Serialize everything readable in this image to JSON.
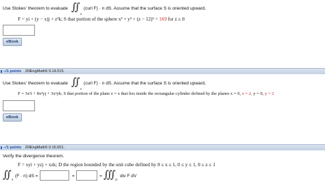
{
  "q1": {
    "intro": "Use Stokes' theorem to evaluate",
    "integrand": "(curl F) · n dS.  Assume that the surface S is oriented upward.",
    "integral_sub": "S",
    "field_line": "F = yi + (y − x)j + z²k;  S that portion of the sphere  x² + y² + (z − 12)² =",
    "field_value_red": "169",
    "field_tail": " for z ≥ 0",
    "ebook_label": "eBook"
  },
  "q2": {
    "bar_points": "–/1 points",
    "bar_ref": "ZillEngMath6 9.14.015.",
    "intro": "Use Stokes' theorem to evaluate",
    "integrand": "(curl F) · n dS.  Assume that the surface S is oriented upward.",
    "integral_sub": "S",
    "field_line": "F = 3x²i + 8x³yj + 3x²yk;  S that portion of the plane  z = x  that lies inside the rectangular cylinder defined by the planes  x = 0,",
    "x_red": "x = 2,",
    "y0": "y = 0,",
    "y_red": "y = 2",
    "ebook_label": "eBook"
  },
  "q3": {
    "bar_points": "–/1 points",
    "bar_ref": "ZillEngMath6 9.16.001.",
    "intro": "Verify the divergence theorem.",
    "field_line": "F = xyi + yzj + xzk;  D the region bounded by the unit cube defined by  0 ≤ x ≤ 1,  0 ≤ y ≤ 1,  0 ≤ z ≤ 1",
    "surface_integrand": "(F · n) dS =",
    "surface_sub": "S",
    "equals": "=",
    "volume_integrand": "div F dV",
    "volume_sub": "D"
  },
  "colors": {
    "accent_red": "#cc1f1f",
    "link_blue": "#1f4fa8",
    "bar_bg": "#c9d6e7"
  }
}
